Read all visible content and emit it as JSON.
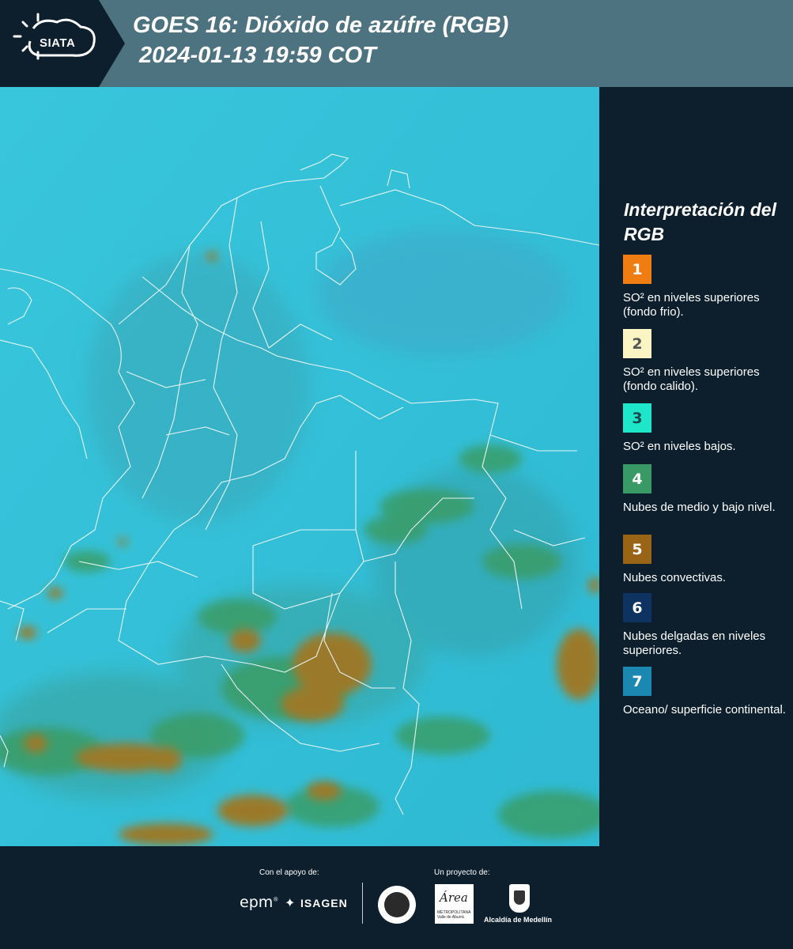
{
  "header": {
    "logo_text": "SIATA",
    "title_line1": "GOES 16: Dióxido de azúfre (RGB)",
    "title_line2": "2024-01-13 19:59 COT"
  },
  "legend": {
    "title": "Interpretación del RGB",
    "items": [
      {
        "number": "1",
        "color": "#f07d12",
        "text": "SO² en niveles superiores (fondo frio)."
      },
      {
        "number": "2",
        "color": "#fbf5c4",
        "text": "SO² en niveles superiores (fondo calido)."
      },
      {
        "number": "3",
        "color": "#1ee6c8",
        "text": "SO² en niveles bajos."
      },
      {
        "number": "4",
        "color": "#3a9a66",
        "text": "Nubes de medio y bajo nivel."
      },
      {
        "number": "5",
        "color": "#9a6416",
        "text": "Nubes convectivas."
      },
      {
        "number": "6",
        "color": "#0f3360",
        "text": "Nubes delgadas en niveles superiores."
      },
      {
        "number": "7",
        "color": "#1a88b0",
        "text": "Oceano/ superficie continental."
      }
    ]
  },
  "footer": {
    "support_label": "Con el apoyo de:",
    "project_label": "Un proyecto de:",
    "epm": "epm",
    "isagen": "ISAGEN",
    "area_script": "Área",
    "area_sub": "METROPOLITANA Valle de Aburrá",
    "alcaldia": "Alcaldía de Medellín"
  },
  "map": {
    "ocean_color": "#36c3d9",
    "cloud_color": "#9a7a2c",
    "low_cloud_color": "#3a9a5a"
  }
}
